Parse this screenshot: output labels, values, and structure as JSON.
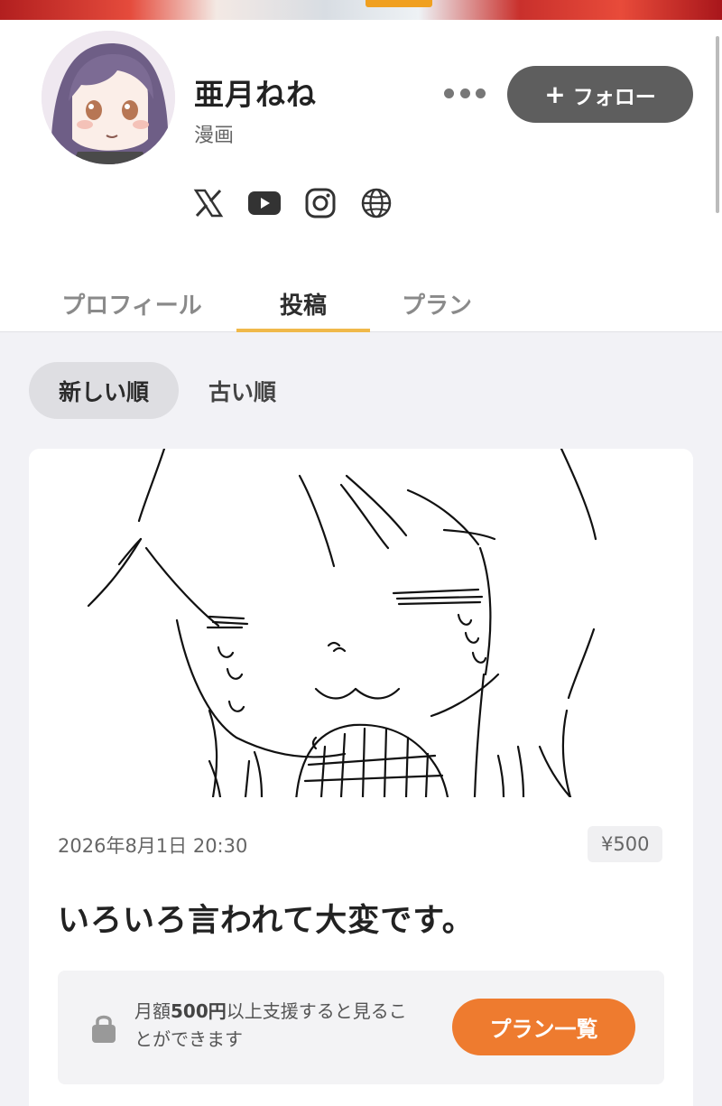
{
  "creator": {
    "name": "亜月ねね",
    "category": "漫画"
  },
  "actions": {
    "follow_label": "フォロー",
    "more_icon": "more-dots-icon"
  },
  "socials": [
    "x-icon",
    "youtube-icon",
    "instagram-icon",
    "globe-icon"
  ],
  "tabs": [
    {
      "label": "プロフィール",
      "active": false
    },
    {
      "label": "投稿",
      "active": true
    },
    {
      "label": "プラン",
      "active": false
    }
  ],
  "sort": [
    {
      "label": "新しい順",
      "active": true
    },
    {
      "label": "古い順",
      "active": false
    }
  ],
  "post": {
    "date": "2026年8月1日 20:30",
    "price": "¥500",
    "title": "いろいろ言われて大変です。",
    "lock_amount": "500円",
    "lock_text_pre": "月額",
    "lock_text_post": "以上支援すると見ることができます",
    "plans_button": "プラン一覧"
  },
  "colors": {
    "accent_orange": "#ee7b2f",
    "tab_underline": "#f0b94a",
    "follow_bg": "#5e5e5e"
  }
}
